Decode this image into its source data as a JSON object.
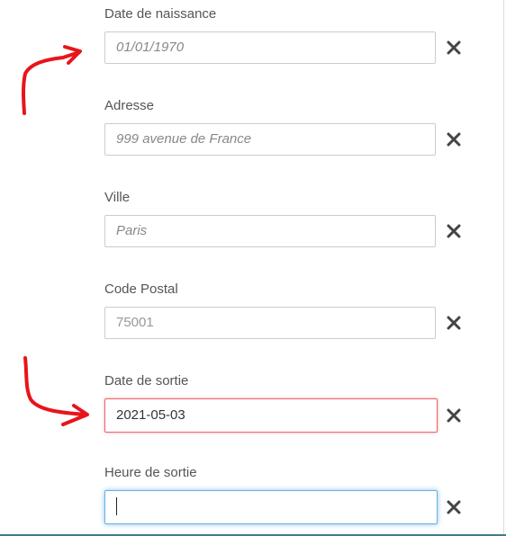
{
  "fields": [
    {
      "label": "Date de naissance",
      "value": "01/01/1970",
      "clear_icon": "close-icon"
    },
    {
      "label": "Adresse",
      "value": "999 avenue de France",
      "clear_icon": "close-icon"
    },
    {
      "label": "Ville",
      "value": "Paris",
      "clear_icon": "close-icon"
    },
    {
      "label": "Code Postal",
      "value": "75001",
      "clear_icon": "close-icon"
    },
    {
      "label": "Date de sortie",
      "value": "2021-05-03",
      "state": "error",
      "clear_icon": "close-icon"
    },
    {
      "label": "Heure de sortie",
      "value": "",
      "state": "focused",
      "clear_icon": "close-icon"
    }
  ],
  "colors": {
    "annotation_arrow": "#e8141b",
    "error_border": "#e8686c",
    "focus_border": "#66afe9"
  }
}
